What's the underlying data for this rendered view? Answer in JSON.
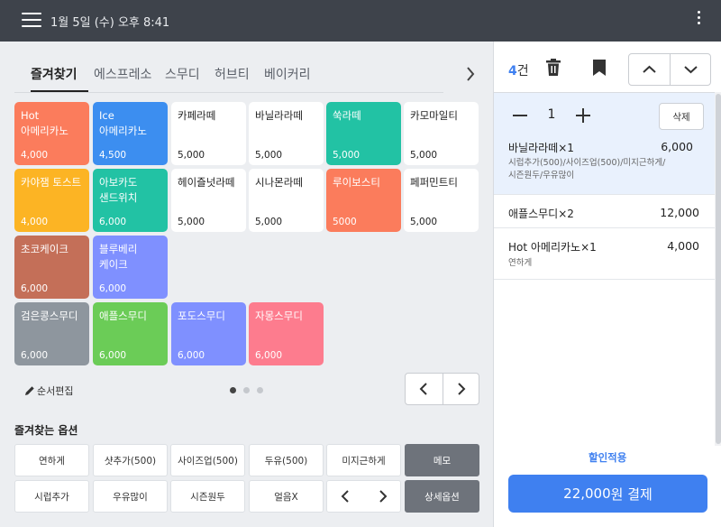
{
  "status_bar": {
    "clock": "1월 5일 (수) 오후 8:41"
  },
  "tabs": [
    {
      "label": "즐겨찾기",
      "active": true
    },
    {
      "label": "에스프레소",
      "active": false
    },
    {
      "label": "스무디",
      "active": false
    },
    {
      "label": "허브티",
      "active": false
    },
    {
      "label": "베이커리",
      "active": false
    }
  ],
  "tiles": [
    {
      "name": "Hot\n아메리카노",
      "price": "4,000",
      "color": "#fb7c5c",
      "text_color": "#ffffff"
    },
    {
      "name": "Ice\n아메리카노",
      "price": "4,500",
      "color": "#3c8ef0",
      "text_color": "#ffffff"
    },
    {
      "name": "카페라떼",
      "price": "5,000",
      "color": "#ffffff",
      "text_color": "#222222"
    },
    {
      "name": "바닐라라떼",
      "price": "5,000",
      "color": "#ffffff",
      "text_color": "#222222"
    },
    {
      "name": "쑥라떼",
      "price": "5,000",
      "color": "#22c2a4",
      "text_color": "#ffffff"
    },
    {
      "name": "카모마일티",
      "price": "5,000",
      "color": "#ffffff",
      "text_color": "#222222"
    },
    {
      "name": "카야잼 토스트",
      "price": "4,000",
      "color": "#fcb424",
      "text_color": "#ffffff"
    },
    {
      "name": "아보카도\n샌드위치",
      "price": "6,000",
      "color": "#22c2a4",
      "text_color": "#ffffff"
    },
    {
      "name": "헤이즐넛라떼",
      "price": "5,000",
      "color": "#ffffff",
      "text_color": "#222222"
    },
    {
      "name": "시나몬라떼",
      "price": "5,000",
      "color": "#ffffff",
      "text_color": "#222222"
    },
    {
      "name": "루이보스티",
      "price": "5000",
      "color": "#fb7c5c",
      "text_color": "#ffffff"
    },
    {
      "name": "페퍼민트티",
      "price": "5,000",
      "color": "#ffffff",
      "text_color": "#222222"
    },
    {
      "name": "초코케이크",
      "price": "6,000",
      "color": "#c46f58",
      "text_color": "#ffffff"
    },
    {
      "name": "블루베리\n케이크",
      "price": "6,000",
      "color": "#7f90ff",
      "text_color": "#ffffff"
    },
    {
      "name": "검은콩스무디",
      "price": "6,000",
      "color": "#8e969e",
      "text_color": "#ffffff"
    },
    {
      "name": "애플스무디",
      "price": "6,000",
      "color": "#6bcc57",
      "text_color": "#ffffff"
    },
    {
      "name": "포도스무디",
      "price": "6,000",
      "color": "#7f90ff",
      "text_color": "#ffffff"
    },
    {
      "name": "자몽스무디",
      "price": "6,000",
      "color": "#fd7c8e",
      "text_color": "#ffffff"
    }
  ],
  "edit_order_label": "순서편집",
  "page_dots": {
    "count": 3,
    "active": 1
  },
  "options": {
    "title": "즐겨찾는 옵션",
    "row1": [
      "연하게",
      "샷추가(500)",
      "사이즈업(500)",
      "두유(500)",
      "미지근하게",
      "메모"
    ],
    "row2": [
      "시럽추가",
      "우유많이",
      "시즌원두",
      "얼음X"
    ],
    "detail_label": "상세옵션"
  },
  "cart": {
    "count_num": "4",
    "count_unit": "건",
    "selected": {
      "qty": "1",
      "delete_label": "삭제",
      "name": "바닐라라떼×1",
      "price": "6,000",
      "options": "시럽추가(500)/사이즈업(500)/미지근하게/시즌원두/우유많이"
    },
    "items": [
      {
        "name": "애플스무디×2",
        "price": "12,000",
        "options": ""
      },
      {
        "name": "Hot 아메리카노×1",
        "price": "4,000",
        "options": "연하게"
      }
    ]
  },
  "discount_label": "할인적용",
  "pay": {
    "amount": "22,000",
    "suffix": "원 결제"
  },
  "colors": {
    "accent": "#3f80f0",
    "topbar": "#3e434b"
  }
}
